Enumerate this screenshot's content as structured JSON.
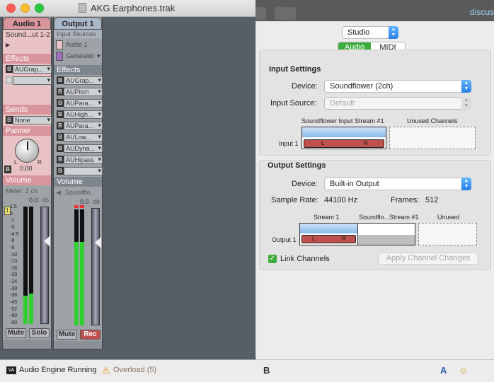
{
  "window": {
    "title": "AKG Earphones.trak"
  },
  "background_app": {
    "partial_text": "discus"
  },
  "strips": [
    {
      "name": "Audio 1",
      "source_label": "Sound...ut 1-2",
      "effects_label": "Effects",
      "effects": [
        "AUGrap..."
      ],
      "sends_label": "Sends",
      "send": "None",
      "panner_label": "Panner",
      "pan_value": "0.00",
      "pan_L": "L",
      "pan_R": "R",
      "volume_label": "Volume",
      "meter_label": "Meter: 2 ch",
      "db_value": "0.0",
      "db_unit": "db",
      "channel_badge": "1",
      "mute_label": "Mute",
      "solo_label": "Solo",
      "meter_levels": [
        0.24,
        0.26
      ]
    },
    {
      "name": "Output 1",
      "input_sources_label": "Input Sources",
      "input_sources": [
        "Audio 1",
        "Generator"
      ],
      "effects_label": "Effects",
      "effects": [
        "AUGrap...",
        "AUPitch",
        "AUPara...",
        "AUHigh...",
        "AUPara...",
        "AULow...",
        "AUDyna...",
        "AUHipass",
        ""
      ],
      "volume_label": "Volume",
      "meter_label": "Soundflo...",
      "db_value": "0.0",
      "db_unit": "db",
      "mute_label": "Mute",
      "rec_label": "Rec",
      "meter_levels": [
        0.72,
        0.72
      ]
    }
  ],
  "scale_ticks": [
    "1.5",
    "0",
    "-1",
    "-3",
    "-4.5",
    "-6",
    "-8",
    "-10",
    "-13",
    "-16",
    "-20",
    "-24",
    "-30",
    "-38",
    "-45",
    "-52",
    "-60",
    "-00"
  ],
  "status": {
    "engine_icon_text": "VA",
    "engine_text": "Audio Engine Running",
    "overload_text": "Overload (5)"
  },
  "panel": {
    "mode": "Studio",
    "tabs": [
      "Audio",
      "MIDI"
    ],
    "input_settings": {
      "title": "Input Settings",
      "device_label": "Device:",
      "device_value": "Soundflower (2ch)",
      "source_label": "Input Source:",
      "source_value": "Default",
      "stream_header": "Soundflower Input Stream #1",
      "unused_header": "Unused Channels",
      "row_label": "Input 1",
      "ch_L": "L",
      "ch_R": "R"
    },
    "output_settings": {
      "title": "Output Settings",
      "device_label": "Device:",
      "device_value": "Built-in Output",
      "sample_rate_label": "Sample Rate:",
      "sample_rate_value": "44100 Hz",
      "frames_label": "Frames:",
      "frames_value": "512",
      "stream1_header": "Stream 1",
      "stream2_header": "Soundflo...Stream #1",
      "unused_header": "Unused",
      "row_label": "Output 1",
      "ch_L": "L",
      "ch_R": "R"
    },
    "link_label": "Link Channels",
    "apply_label": "Apply Channel Changes"
  },
  "colors": {
    "accent_green": "#3dae3d",
    "blue_arrow": "#2a7de8",
    "channel_red": "#c0504d"
  }
}
